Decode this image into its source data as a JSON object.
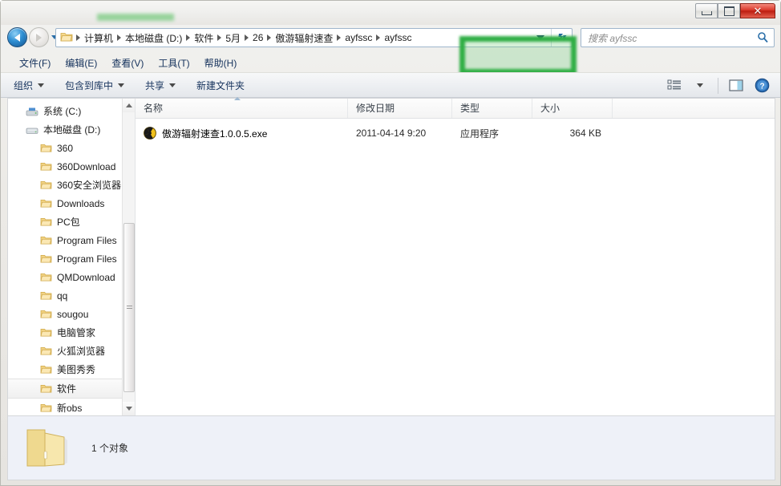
{
  "window": {
    "controls": {
      "minimize": "minimize-button",
      "maximize": "maximize-button",
      "close": "✕"
    }
  },
  "address": {
    "folder_icon": "folder-icon",
    "breadcrumbs": [
      "计算机",
      "本地磁盘 (D:)",
      "软件",
      "5月",
      "26",
      "傲游辐射速查",
      "ayfssc",
      "ayfssc"
    ],
    "refresh_label": "↻",
    "dropdown_icon": "chevron-down-icon"
  },
  "search": {
    "placeholder": "搜索 ayfssc",
    "icon": "search-icon"
  },
  "menu": {
    "items": [
      {
        "text": "文件(F)",
        "label": "文件",
        "accel": "F"
      },
      {
        "text": "编辑(E)",
        "label": "编辑",
        "accel": "E"
      },
      {
        "text": "查看(V)",
        "label": "查看",
        "accel": "V"
      },
      {
        "text": "工具(T)",
        "label": "工具",
        "accel": "T"
      },
      {
        "text": "帮助(H)",
        "label": "帮助",
        "accel": "H"
      }
    ]
  },
  "toolbar": {
    "organize": "组织",
    "include_in_library": "包含到库中",
    "share": "共享",
    "new_folder": "新建文件夹",
    "view_icon": "view-list-icon",
    "preview_pane_icon": "preview-pane-icon",
    "help_icon": "help-icon"
  },
  "sidebar": {
    "items": [
      {
        "label": "系统 (C:)",
        "icon": "drive-system-icon",
        "level": 0,
        "selected": false
      },
      {
        "label": "本地磁盘 (D:)",
        "icon": "drive-icon",
        "level": 0,
        "selected": false
      },
      {
        "label": "360",
        "icon": "folder-icon",
        "level": 1,
        "selected": false
      },
      {
        "label": "360Download",
        "icon": "folder-icon",
        "level": 1,
        "selected": false
      },
      {
        "label": "360安全浏览器",
        "icon": "folder-icon",
        "level": 1,
        "selected": false
      },
      {
        "label": "Downloads",
        "icon": "folder-icon",
        "level": 1,
        "selected": false
      },
      {
        "label": "PC包",
        "icon": "folder-icon",
        "level": 1,
        "selected": false
      },
      {
        "label": "Program Files",
        "icon": "folder-icon",
        "level": 1,
        "selected": false
      },
      {
        "label": "Program Files",
        "icon": "folder-icon",
        "level": 1,
        "selected": false
      },
      {
        "label": "QMDownload",
        "icon": "folder-icon",
        "level": 1,
        "selected": false
      },
      {
        "label": "qq",
        "icon": "folder-icon",
        "level": 1,
        "selected": false
      },
      {
        "label": "sougou",
        "icon": "folder-icon",
        "level": 1,
        "selected": false
      },
      {
        "label": "电脑管家",
        "icon": "folder-icon",
        "level": 1,
        "selected": false
      },
      {
        "label": "火狐浏览器",
        "icon": "folder-icon",
        "level": 1,
        "selected": false
      },
      {
        "label": "美图秀秀",
        "icon": "folder-icon",
        "level": 1,
        "selected": false
      },
      {
        "label": "软件",
        "icon": "folder-icon",
        "level": 1,
        "selected": true
      },
      {
        "label": "新obs",
        "icon": "folder-icon",
        "level": 1,
        "selected": false
      }
    ]
  },
  "filelist": {
    "columns": [
      "名称",
      "修改日期",
      "类型",
      "大小"
    ],
    "rows": [
      {
        "name": "傲游辐射速查1.0.0.5.exe",
        "date": "2011-04-14 9:20",
        "type": "应用程序",
        "size": "364 KB",
        "icon": "radiation-icon"
      }
    ]
  },
  "statusbar": {
    "text": "1 个对象",
    "icon": "folder-large-icon"
  },
  "colors": {
    "accent_blue": "#2e8ed2",
    "highlight_green": "#2fae44",
    "close_red": "#d9382a",
    "folder_yellow": "#f5d88a"
  }
}
